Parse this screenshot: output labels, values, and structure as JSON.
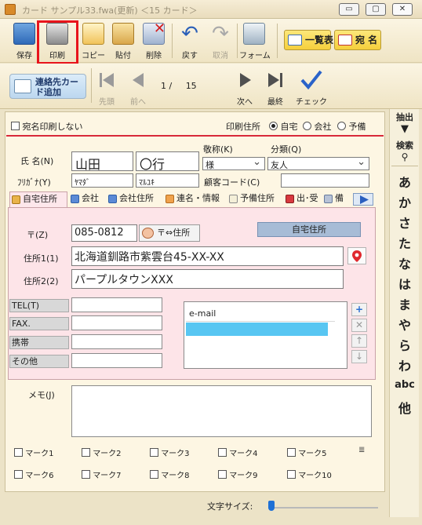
{
  "window": {
    "title": "カード サンプル33.fwa(更新)  ＜15 カード＞",
    "min_label": "▭",
    "max_label": "▢",
    "close_label": "✕"
  },
  "toolbar": {
    "save": "保存",
    "print": "印刷",
    "copy": "コピー",
    "paste": "貼付",
    "delete": "削除",
    "undo": "戻す",
    "redo": "取消",
    "form": "フォーム",
    "list": "一覧表",
    "addressee": "宛 名"
  },
  "nav": {
    "add_card": "連絡先カード追加",
    "first": "先頭",
    "prev": "前へ",
    "current": "1",
    "total": "15",
    "next": "次へ",
    "last": "最終",
    "check": "チェック"
  },
  "form": {
    "no_print_label": "宛名印刷しない",
    "print_address_label": "印刷住所",
    "print_address_options": [
      "自宅",
      "会社",
      "予備"
    ],
    "print_address_selected": "自宅",
    "name_label": "氏 名(N)",
    "surname": "山田",
    "given_name": "〇行",
    "furigana_label": "ﾌﾘｶﾞﾅ(Y)",
    "surname_kana": "ﾔﾏﾀﾞ",
    "given_name_kana": "ﾏﾙﾕｷ",
    "honorific_label": "敬称(K)",
    "honorific_value": "様",
    "category_label": "分類(Q)",
    "category_value": "友人",
    "customer_code_label": "顧客コード(C)",
    "customer_code_value": ""
  },
  "tabs": [
    "自宅住所",
    "会社",
    "会社住所",
    "連名・情報",
    "予備住所",
    "出･受",
    "備"
  ],
  "address": {
    "zip_label": "〒(Z)",
    "zip_value": "085-0812",
    "zip_button": "〒⇔住所",
    "address_type": "自宅住所",
    "addr1_label": "住所1(1)",
    "addr1_value": "北海道釧路市紫雲台45-XX-XX",
    "addr2_label": "住所2(2)",
    "addr2_value": "パープルタウンXXX",
    "tel_label": "TEL(T)",
    "fax_label": "FAX.",
    "mobile_label": "携帯",
    "other_label": "その他",
    "email_label": "e-mail"
  },
  "memo": {
    "label": "メモ(J)",
    "value": ""
  },
  "marks": [
    "マーク1",
    "マーク2",
    "マーク3",
    "マーク4",
    "マーク5",
    "マーク6",
    "マーク7",
    "マーク8",
    "マーク9",
    "マーク10"
  ],
  "bottom": {
    "font_size_label": "文字サイズ:"
  },
  "sidebar": {
    "filter_label": "抽出",
    "search_label": "検索",
    "kana": [
      "あ",
      "か",
      "さ",
      "た",
      "な",
      "は",
      "ま",
      "や",
      "ら",
      "わ",
      "abc",
      "他"
    ]
  }
}
